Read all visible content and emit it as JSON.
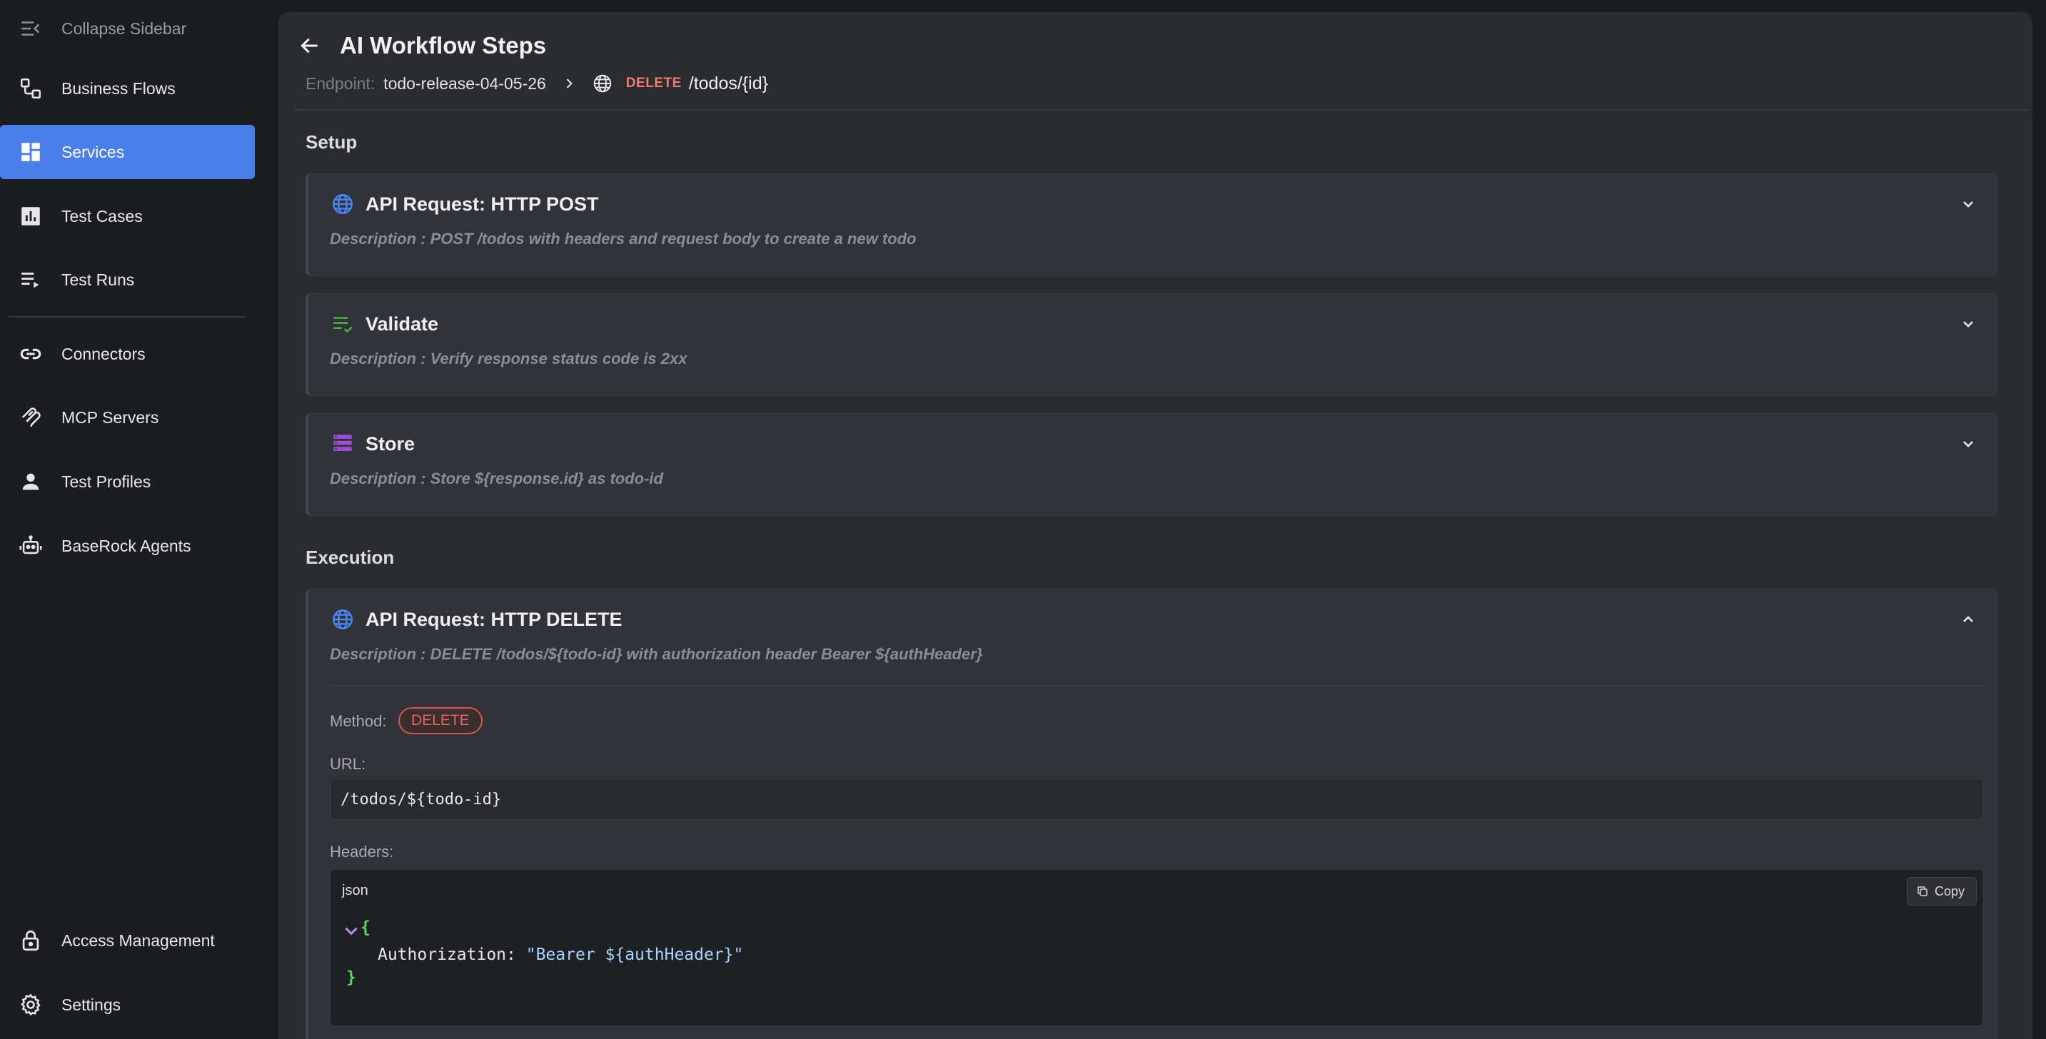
{
  "sidebar": {
    "collapse_label": "Collapse Sidebar",
    "items": [
      {
        "label": "Business Flows"
      },
      {
        "label": "Services"
      },
      {
        "label": "Test Cases"
      },
      {
        "label": "Test Runs"
      },
      {
        "label": "Connectors"
      },
      {
        "label": "MCP Servers"
      },
      {
        "label": "Test Profiles"
      },
      {
        "label": "BaseRock Agents"
      }
    ],
    "bottom_items": [
      {
        "label": "Access Management"
      },
      {
        "label": "Settings"
      }
    ],
    "active_item": "Services",
    "accent_color": "#4a7ee8"
  },
  "header": {
    "title": "AI Workflow Steps",
    "endpoint_label": "Endpoint:",
    "endpoint_value": "todo-release-04-05-26",
    "method": "DELETE",
    "path": "/todos/{id}"
  },
  "sections": {
    "setup": "Setup",
    "execution": "Execution"
  },
  "steps": [
    {
      "icon": "globe-icon",
      "title": "API Request: HTTP POST",
      "description": "Description : POST /todos with headers and request body to create a new todo"
    },
    {
      "icon": "validate-check-icon",
      "title": "Validate",
      "description": "Description : Verify response status code is 2xx"
    },
    {
      "icon": "store-icon",
      "title": "Store",
      "description": "Description : Store ${response.id} as todo-id"
    },
    {
      "icon": "globe-icon",
      "title": "API Request: HTTP DELETE",
      "description": "Description : DELETE /todos/${todo-id} with authorization header Bearer ${authHeader}"
    }
  ],
  "expanded": {
    "method_label": "Method:",
    "method_value": "DELETE",
    "url_label": "URL:",
    "url_value": "/todos/${todo-id}",
    "headers_label": "Headers:",
    "code_lang": "json",
    "copy_label": "Copy",
    "code_open": "{",
    "code_key": "Authorization:",
    "code_value": "\"Bearer ${authHeader}\"",
    "code_close": "}"
  }
}
